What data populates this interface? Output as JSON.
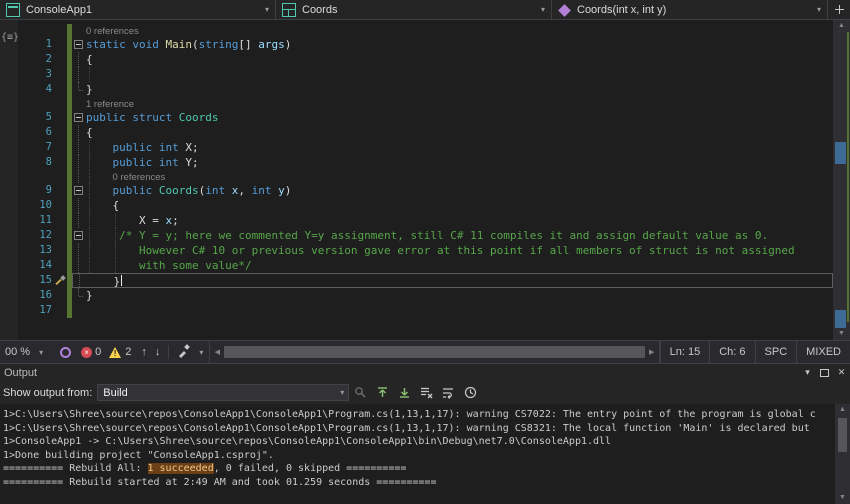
{
  "nav": {
    "sections": [
      {
        "label": "ConsoleApp1",
        "icon": "csharp-project-icon"
      },
      {
        "label": "Coords",
        "icon": "struct-icon"
      },
      {
        "label": "Coords(int x, int y)",
        "icon": "method-icon"
      }
    ]
  },
  "editor": {
    "glyph_margin_icon": "code-outline-icon",
    "rows": [
      {
        "type": "codelens",
        "text": "0 references",
        "indent": 0
      },
      {
        "type": "code",
        "num": 1,
        "outline": "box",
        "segments": [
          [
            "static void",
            "kw"
          ],
          [
            " ",
            "pl"
          ],
          [
            "Main",
            "me sq"
          ],
          [
            "(",
            "pl"
          ],
          [
            "string",
            "kw"
          ],
          [
            "[] ",
            "pl"
          ],
          [
            "args",
            "pa"
          ],
          [
            ")",
            "pl"
          ]
        ]
      },
      {
        "type": "code",
        "num": 2,
        "outline": "v",
        "segments": [
          [
            "{",
            "pl"
          ]
        ]
      },
      {
        "type": "code",
        "num": 3,
        "outline": "v",
        "guides": [
          0
        ],
        "segments": []
      },
      {
        "type": "code",
        "num": 4,
        "outline": "end",
        "segments": [
          [
            "}",
            "pl"
          ]
        ]
      },
      {
        "type": "codelens",
        "text": "1 reference",
        "indent": 0
      },
      {
        "type": "code",
        "num": 5,
        "outline": "box",
        "segments": [
          [
            "public struct",
            "kw"
          ],
          [
            " ",
            "pl"
          ],
          [
            "Coords",
            "ty"
          ]
        ]
      },
      {
        "type": "code",
        "num": 6,
        "outline": "v",
        "segments": [
          [
            "{",
            "pl"
          ]
        ]
      },
      {
        "type": "code",
        "num": 7,
        "outline": "v",
        "guides": [
          0
        ],
        "segments": [
          [
            "    ",
            "pl"
          ],
          [
            "public int",
            "kw"
          ],
          [
            " X;",
            "pl"
          ]
        ]
      },
      {
        "type": "code",
        "num": 8,
        "outline": "v",
        "guides": [
          0
        ],
        "segments": [
          [
            "    ",
            "pl"
          ],
          [
            "public int",
            "kw"
          ],
          [
            " Y;",
            "pl"
          ]
        ]
      },
      {
        "type": "codelens",
        "text": "0 references",
        "indent": 4,
        "outline": "v",
        "guides": [
          0
        ]
      },
      {
        "type": "code",
        "num": 9,
        "outline": "box",
        "guides": [
          0
        ],
        "segments": [
          [
            "    ",
            "pl"
          ],
          [
            "public",
            "kw"
          ],
          [
            " ",
            "pl"
          ],
          [
            "Coords",
            "ty"
          ],
          [
            "(",
            "pl"
          ],
          [
            "int",
            "kw"
          ],
          [
            " ",
            "pl"
          ],
          [
            "x",
            "pa"
          ],
          [
            ", ",
            "pl"
          ],
          [
            "int",
            "kw"
          ],
          [
            " ",
            "pl"
          ],
          [
            "y",
            "pa"
          ],
          [
            ")",
            "pl"
          ]
        ]
      },
      {
        "type": "code",
        "num": 10,
        "outline": "v",
        "guides": [
          0
        ],
        "segments": [
          [
            "    {",
            "pl"
          ]
        ]
      },
      {
        "type": "code",
        "num": 11,
        "outline": "v",
        "guides": [
          0,
          4
        ],
        "segments": [
          [
            "        X = ",
            "pl"
          ],
          [
            "x",
            "pa"
          ],
          [
            ";",
            "pl"
          ]
        ]
      },
      {
        "type": "code",
        "num": 12,
        "outline": "box",
        "guides": [
          0,
          4
        ],
        "segments": [
          [
            "     ",
            "pl"
          ],
          [
            "/* Y = y; here we commented Y=y assignment, still C# 11 compiles it and assign default value as 0.",
            "cm"
          ]
        ]
      },
      {
        "type": "code",
        "num": 13,
        "outline": "v",
        "guides": [
          0,
          4
        ],
        "segments": [
          [
            "        ",
            "pl"
          ],
          [
            "However C# 10 or previous version gave error at this point if all members of struct is not assigned",
            "cm"
          ]
        ]
      },
      {
        "type": "code",
        "num": 14,
        "outline": "v",
        "guides": [
          0,
          4
        ],
        "segments": [
          [
            "        ",
            "pl"
          ],
          [
            "with some value*/",
            "cm"
          ]
        ]
      },
      {
        "type": "code",
        "num": 15,
        "outline": "v",
        "cur": true,
        "quick": true,
        "segments": [
          [
            "    }",
            "pl"
          ]
        ]
      },
      {
        "type": "code",
        "num": 16,
        "outline": "end",
        "segments": [
          [
            "}",
            "pl"
          ]
        ]
      },
      {
        "type": "code",
        "num": 17,
        "segments": []
      }
    ]
  },
  "editor_status": {
    "zoom": "00 %",
    "error_count": "0",
    "warning_count": "2",
    "line": "Ln: 15",
    "column": "Ch: 6",
    "spaces": "SPC",
    "line_ending": "MIXED"
  },
  "output": {
    "title": "Output",
    "show_output_from_label": "Show output from:",
    "source_selected": "Build",
    "toolbar_icons": [
      "find-message-icon",
      "goto-previous-message-icon",
      "goto-next-message-icon",
      "clear-all-icon",
      "toggle-word-wrap-icon",
      "timestamp-icon"
    ],
    "window_icons": [
      "chevron-down-icon",
      "float-window-icon",
      "close-icon"
    ],
    "lines": [
      {
        "text": "1>C:\\Users\\Shree\\source\\repos\\ConsoleApp1\\ConsoleApp1\\Program.cs(1,13,1,17): warning CS7022: The entry point of the program is global c"
      },
      {
        "text": "1>C:\\Users\\Shree\\source\\repos\\ConsoleApp1\\ConsoleApp1\\Program.cs(1,13,1,17): warning CS8321: The local function 'Main' is declared but"
      },
      {
        "text": "1>ConsoleApp1 -> C:\\Users\\Shree\\source\\repos\\ConsoleApp1\\ConsoleApp1\\bin\\Debug\\net7.0\\ConsoleApp1.dll"
      },
      {
        "text": "1>Done building project \"ConsoleApp1.csproj\"."
      },
      {
        "before": "========== Rebuild All: ",
        "highlight": "1 succeeded",
        "after": ", 0 failed, 0 skipped =========="
      },
      {
        "text": "========== Rebuild started at 2:49 AM and took 01.259 seconds =========="
      }
    ]
  },
  "colors": {
    "keyword": "#569CD6",
    "type": "#4EC9B0",
    "method": "#DCDCAA",
    "parameter": "#9CDCFE",
    "comment": "#57A64A",
    "line_number": "#4EA1BE",
    "change_tracking": "#577430",
    "error": "#D64A53",
    "warning": "#FCD34D",
    "succeeded_highlight_bg": "#6C3F14"
  }
}
